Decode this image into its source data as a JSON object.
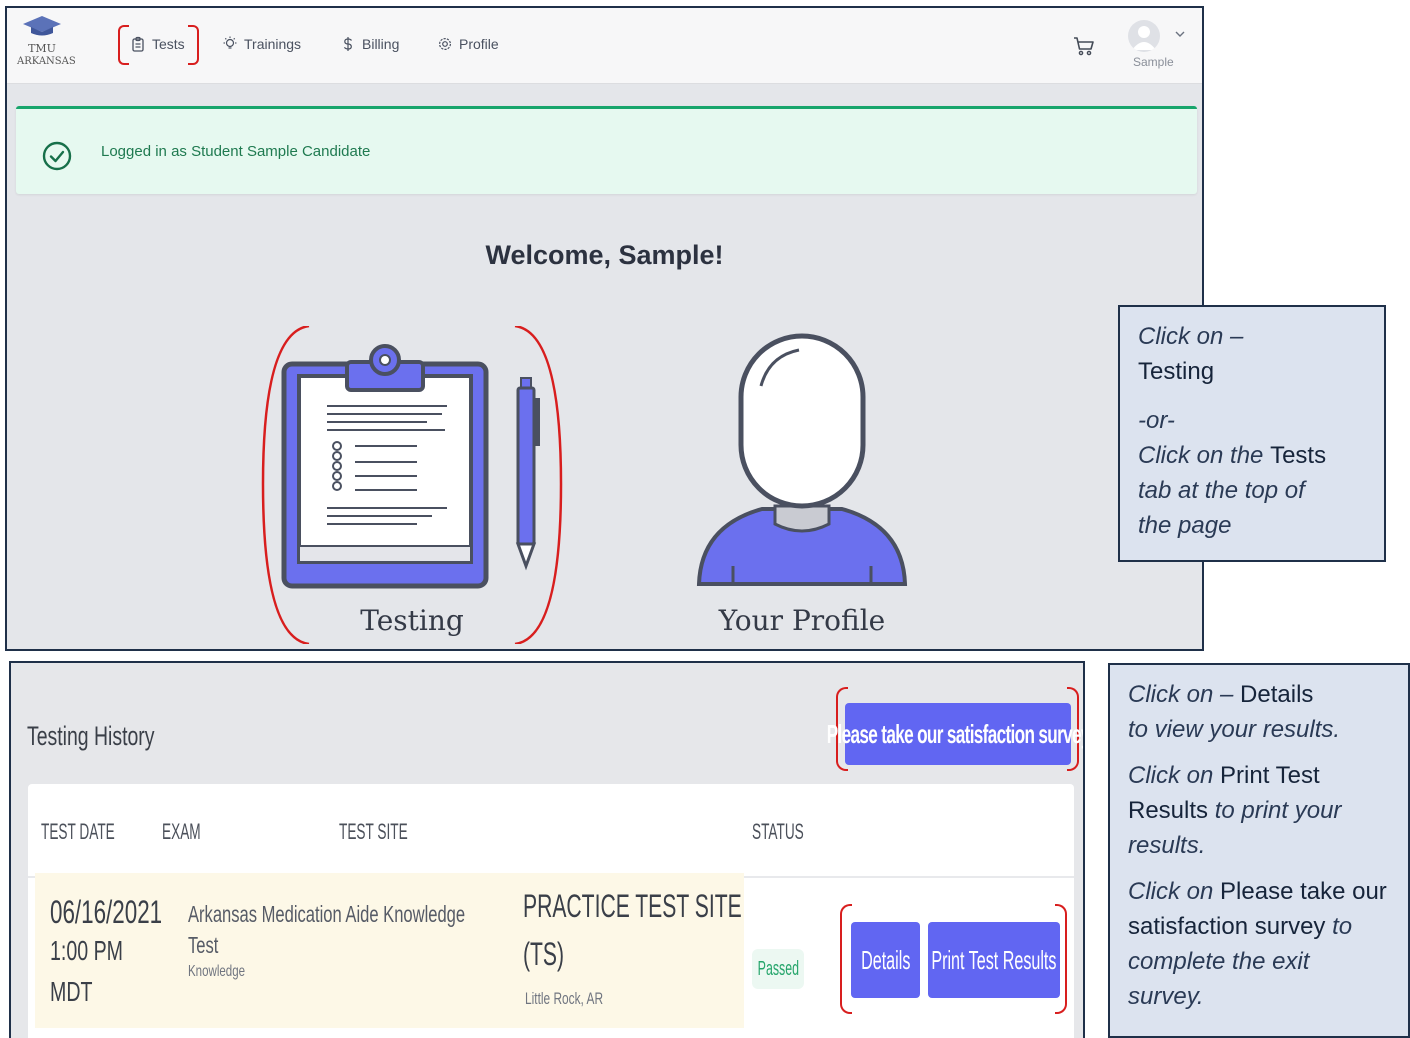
{
  "nav": {
    "logo_line1": "TMU",
    "logo_line2": "ARKANSAS",
    "items": [
      {
        "label": "Tests",
        "icon": "clipboard-icon"
      },
      {
        "label": "Trainings",
        "icon": "lightbulb-icon"
      },
      {
        "label": "Billing",
        "icon": "dollar-icon"
      },
      {
        "label": "Profile",
        "icon": "gear-icon"
      }
    ],
    "cart_icon": "cart-icon",
    "user_name": "Sample"
  },
  "alert": {
    "text": "Logged in as Student Sample Candidate",
    "icon": "check-circle-icon",
    "color": "#18a56c"
  },
  "welcome": "Welcome, Sample!",
  "cards": [
    {
      "label": "Testing",
      "icon": "clipboard-pencil-icon"
    },
    {
      "label": "Your Profile",
      "icon": "person-icon"
    }
  ],
  "note_top": {
    "line1": "Click on –",
    "line2": "Testing",
    "line3": "-or-",
    "line4a": "Click on the ",
    "line4b": "Tests",
    "line5": "tab at the top of",
    "line6": "the page"
  },
  "history": {
    "title": "Testing History",
    "survey_button": "Please take our satisfaction survey",
    "columns": [
      "TEST DATE",
      "EXAM",
      "TEST SITE",
      "STATUS"
    ],
    "rows": [
      {
        "date": "06/16/2021",
        "time": "1:00 PM",
        "tz": "MDT",
        "exam": "Arkansas Medication Aide Knowledge",
        "exam2": "Test",
        "exam_type": "Knowledge",
        "site": "PRACTICE TEST SITE",
        "site2": "(TS)",
        "location": "Little Rock, AR",
        "status": "Passed",
        "details_button": "Details",
        "print_button": "Print Test Results"
      }
    ]
  },
  "note_bottom": {
    "p1a": "Click on – ",
    "p1b": "Details",
    "p1c": "to view your results.",
    "p2a": "Click on ",
    "p2b": "Print Test Results",
    "p2c": " to print your results.",
    "p3a": "Click on ",
    "p3b": "Please take our satisfaction survey",
    "p3c": " to complete the exit survey."
  },
  "colors": {
    "accent": "#6166f2",
    "annotation_red": "#d81e1e",
    "success": "#18a56c"
  }
}
